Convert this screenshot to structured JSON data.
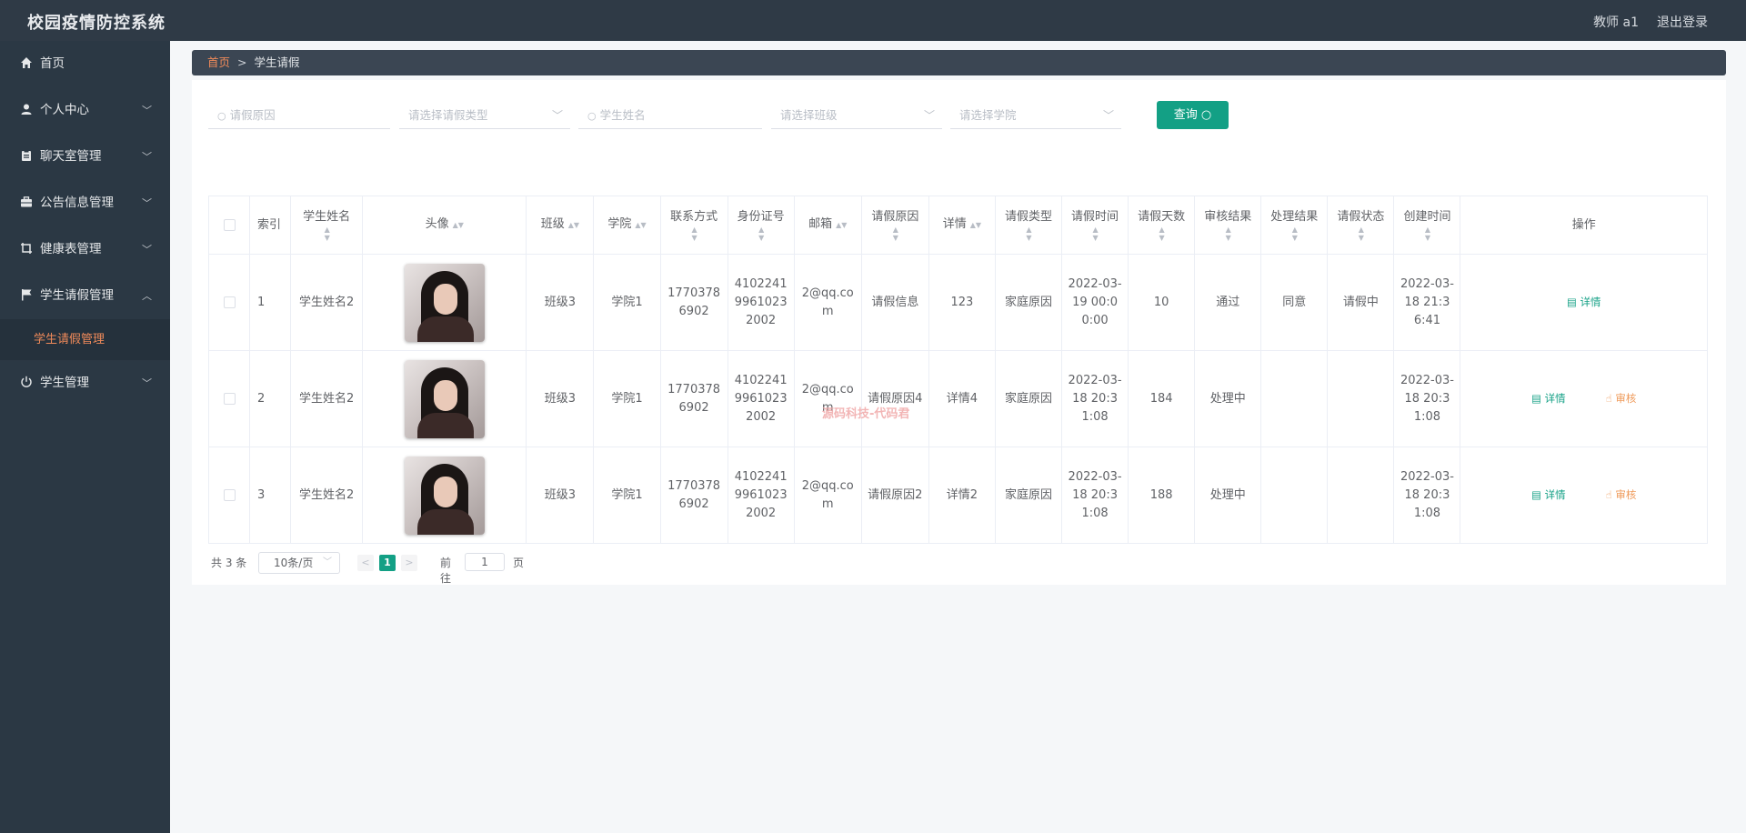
{
  "header": {
    "app_title": "校园疫情防控系统",
    "user": "教师 a1",
    "logout": "退出登录"
  },
  "sidebar": {
    "items": [
      {
        "label": "首页",
        "icon": "home-icon"
      },
      {
        "label": "个人中心",
        "icon": "user-icon"
      },
      {
        "label": "聊天室管理",
        "icon": "clipboard-icon"
      },
      {
        "label": "公告信息管理",
        "icon": "briefcase-icon"
      },
      {
        "label": "健康表管理",
        "icon": "crop-icon"
      },
      {
        "label": "学生请假管理",
        "icon": "flag-icon"
      },
      {
        "label": "学生管理",
        "icon": "power-icon"
      }
    ],
    "active_sub": "学生请假管理"
  },
  "breadcrumb": {
    "home": "首页",
    "sep": ">",
    "current": "学生请假"
  },
  "search": {
    "reason_placeholder": "请假原因",
    "type_placeholder": "请选择请假类型",
    "name_placeholder": "学生姓名",
    "class_placeholder": "请选择班级",
    "college_placeholder": "请选择学院",
    "button": "查询"
  },
  "table": {
    "headers": {
      "index": "索引",
      "name": "学生姓名",
      "avatar": "头像",
      "class": "班级",
      "college": "学院",
      "phone": "联系方式",
      "idcard": "身份证号",
      "email": "邮箱",
      "reason": "请假原因",
      "detail": "详情",
      "type": "请假类型",
      "time": "请假时间",
      "days": "请假天数",
      "audit": "审核结果",
      "result": "处理结果",
      "status": "请假状态",
      "created": "创建时间",
      "ops": "操作"
    },
    "rows": [
      {
        "index": "1",
        "name": "学生姓名2",
        "class": "班级3",
        "college": "学院1",
        "phone": "17703786902",
        "idcard": "410224199610232002",
        "email": "2@qq.com",
        "reason": "请假信息",
        "detail": "123",
        "type": "家庭原因",
        "time": "2022-03-19 00:00:00",
        "days": "10",
        "audit": "通过",
        "result": "同意",
        "status": "请假中",
        "created": "2022-03-18 21:36:41",
        "op_detail": "详情"
      },
      {
        "index": "2",
        "name": "学生姓名2",
        "class": "班级3",
        "college": "学院1",
        "phone": "17703786902",
        "idcard": "410224199610232002",
        "email": "2@qq.com",
        "reason": "请假原因4",
        "detail": "详情4",
        "type": "家庭原因",
        "time": "2022-03-18 20:31:08",
        "days": "184",
        "audit": "处理中",
        "result": "",
        "status": "",
        "created": "2022-03-18 20:31:08",
        "op_detail": "详情",
        "op_audit": "审核"
      },
      {
        "index": "3",
        "name": "学生姓名2",
        "class": "班级3",
        "college": "学院1",
        "phone": "17703786902",
        "idcard": "410224199610232002",
        "email": "2@qq.com",
        "reason": "请假原因2",
        "detail": "详情2",
        "type": "家庭原因",
        "time": "2022-03-18 20:31:08",
        "days": "188",
        "audit": "处理中",
        "result": "",
        "status": "",
        "created": "2022-03-18 20:31:08",
        "op_detail": "详情",
        "op_audit": "审核"
      }
    ]
  },
  "watermark": "源码科技-代码君",
  "pagination": {
    "total": "共 3 条",
    "page_size": "10条/页",
    "prev": "<",
    "current": "1",
    "next": ">",
    "goto_label": "前往",
    "goto_value": "1",
    "page_unit": "页"
  },
  "colors": {
    "accent": "#13a085",
    "orange": "#ef8a5a",
    "sidebar_bg": "#2b3844",
    "header_bg": "#2f3a46"
  }
}
